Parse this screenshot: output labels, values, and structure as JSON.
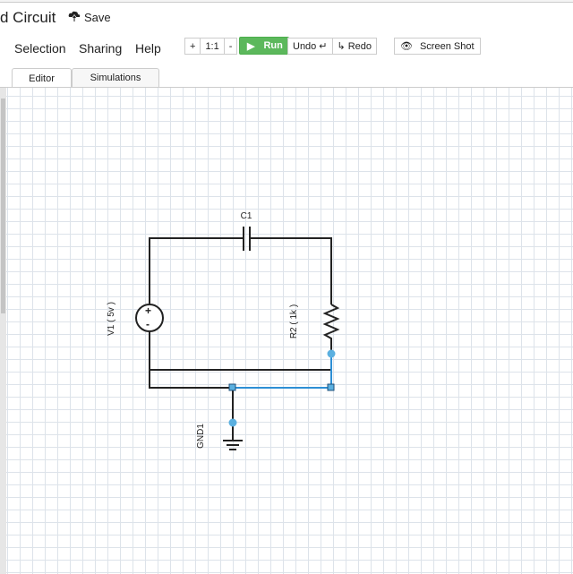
{
  "header": {
    "title": "d Circuit",
    "save_label": "Save"
  },
  "menu": [
    "Selection",
    "Sharing",
    "Help"
  ],
  "toolbar": {
    "zoom_in": "+",
    "zoom_reset": "1:1",
    "zoom_out": "-",
    "run": "Run",
    "undo": "Undo",
    "redo": "Redo",
    "screenshot": "Screen Shot",
    "run_color": "#5cb85c"
  },
  "tabs": [
    {
      "label": "Editor",
      "active": true
    },
    {
      "label": "Simulations",
      "active": false
    }
  ],
  "circuit": {
    "capacitor": "C1",
    "voltage_source": "V1 ( 5v )",
    "resistor": "R2 ( 1k )",
    "ground": "GND1",
    "selection_color": "#2d8fd5"
  }
}
